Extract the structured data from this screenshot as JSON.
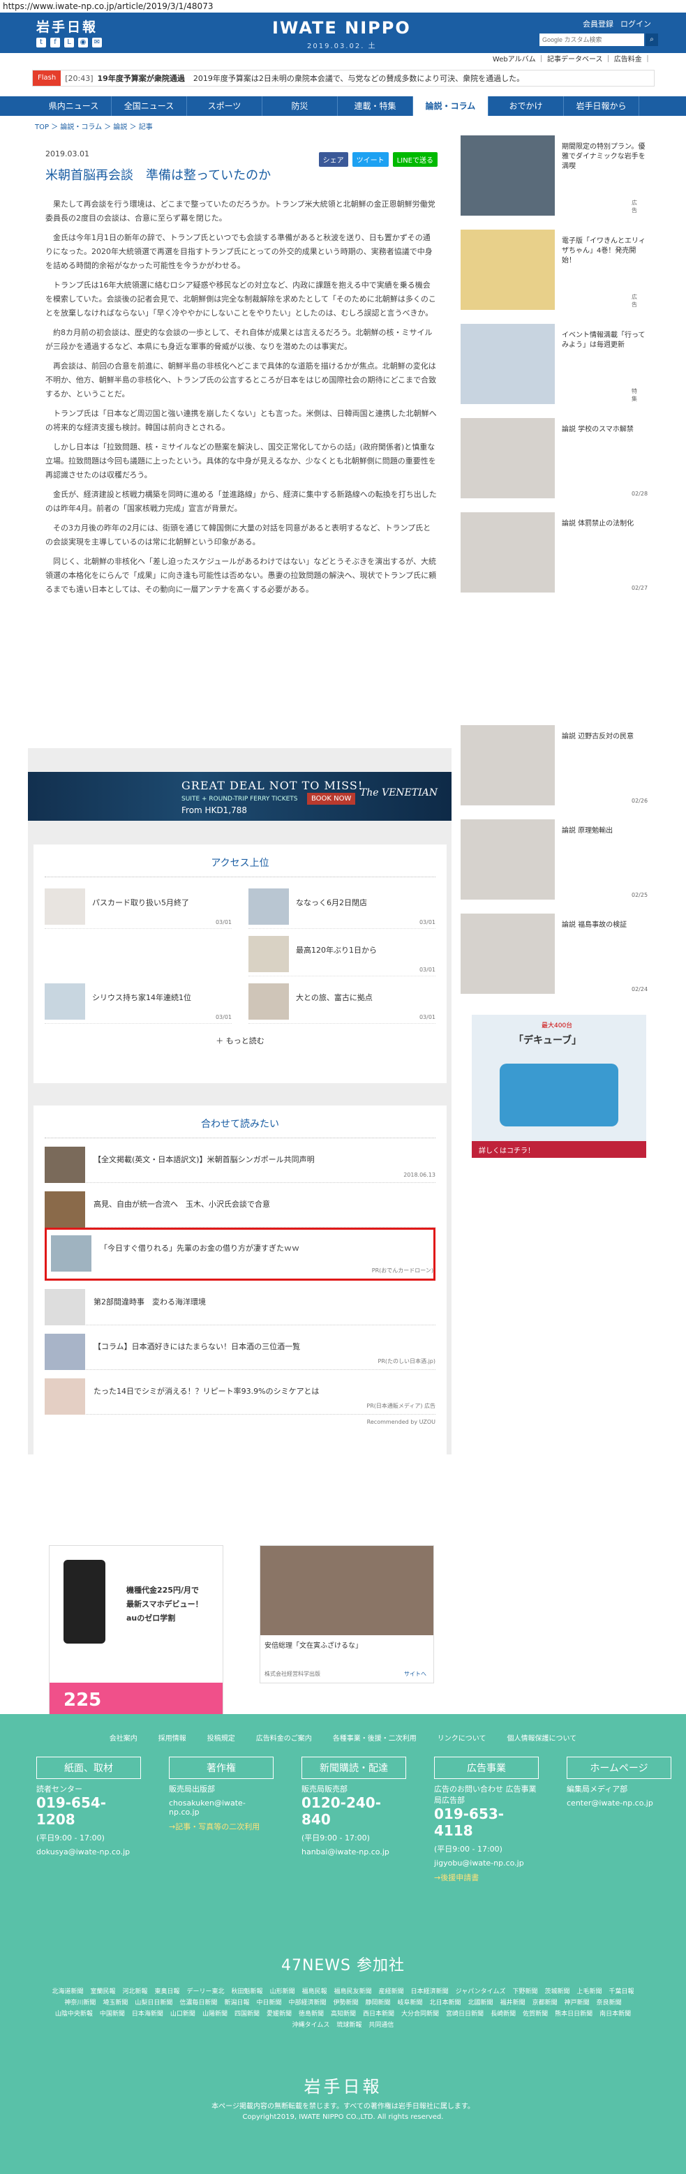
{
  "url": "https://www.iwate-np.co.jp/article/2019/3/1/48073",
  "header": {
    "logo": "岩手日報",
    "brand": "IWATE NIPPO",
    "brand_date": "2019.03.02. 土",
    "links": [
      "会員登録",
      "ログイン"
    ],
    "search_placeholder": "Google カスタム検索",
    "sub_links": "Webアルバム ｜ 記事データベース ｜ 広告料金 ｜"
  },
  "flash": {
    "tag": "Flash",
    "time": "[20:43]",
    "title": "19年度予算案が衆院通過",
    "text": "2019年度予算案は2日未明の衆院本会議で、与党などの賛成多数により可決、衆院を通過した。"
  },
  "nav": [
    "県内ニュース",
    "全国ニュース",
    "スポーツ",
    "防災",
    "連載・特集",
    "論説・コラム",
    "おでかけ",
    "岩手日報から"
  ],
  "breadcrumb": "TOP ＞ 論説・コラム ＞ 論説 ＞ 記事",
  "article": {
    "date": "2019.03.01",
    "title": "米朝首脳再会談　準備は整っていたのか",
    "share": [
      "シェア",
      "ツイート",
      "LINEで送る"
    ],
    "paragraphs": [
      "果たして再会談を行う環境は、どこまで整っていたのだろうか。トランプ米大統領と北朝鮮の金正恩朝鮮労働党委員長の2度目の会談は、合意に至らず幕を閉じた。",
      "金氏は今年1月1日の新年の辞で、トランプ氏といつでも会談する準備があると秋波を送り、日も置かずその通りになった。2020年大統領選で再選を目指すトランプ氏にとっての外交的成果という時期の、実務者協議で中身を詰める時間的余裕がなかった可能性を今うかがわせる。",
      "トランプ氏は16年大統領選に絡むロシア疑惑や移民などの対立など、内政に課題を抱える中で実績を乗る機会を模索していた。会談後の記者会見で、北朝鮮側は完全な制裁解除を求めたとして「そのために北朝鮮は多くのことを放棄しなければならない」「早く冷ややかにしないことをやりたい」としたのは、むしろ誤認と言うべきか。",
      "約8カ月前の初会談は、歴史的な会談の一歩として、それ自体が成果とは言えるだろう。北朝鮮の核・ミサイルが三段かを通過するなど、本県にも身近な軍事的脅威が以後、なりを潜めたのは事実だ。",
      "再会談は、前回の合意を前進に、朝鮮半島の非核化へどこまで具体的な道筋を描けるかが焦点。北朝鮮の変化は不明か、他方、朝鮮半島の非核化へ、トランプ氏の公言するところが日本をはじめ国際社会の期待にどこまで合致するか、ということだ。",
      "トランプ氏は「日本など周辺国と強い連携を崩したくない」とも言った。米側は、日韓両国と連携した北朝鮮への将来的な経済支援も検討。韓国は前向きとされる。",
      "しかし日本は「拉致問題、核・ミサイルなどの懸案を解決し、国交正常化してからの話」(政府関係者)と慎重な立場。拉致問題は今回も議題に上ったという。具体的な中身が見えるなか、少なくとも北朝鮮側に問題の重要性を再認識させたのは収穫だろう。",
      "金氏が、経済建設と核戦力構築を同時に進める「並進路線」から、経済に集中する新路線への転換を打ち出したのは昨年4月。前者の「国家核戦力完成」宣言が背景だ。",
      "その3カ月後の昨年の2月には、街頭を通じて韓国側に大量の対話を同意があると表明するなど、トランプ氏との会談実現を主導しているのは常に北朝鮮という印象がある。",
      "同じく、北朝鮮の非核化へ「差し迫ったスケジュールがあるわけではない」などとうそぶきを演出するが、大統領選の本格化をにらんで「成果」に向き逢も可能性は否めない。愚妻の拉致問題の解決へ、現状でトランプ氏に頼るまでも遠い日本としては、その動向に一層アンテナを高くする必要がある。"
    ]
  },
  "ad_banner": {
    "headline": "GREAT DEAL NOT TO MISS!",
    "sub": "SUITE + ROUND-TRIP FERRY TICKETS",
    "price": "From HKD1,788",
    "button": "BOOK NOW",
    "brand": "The VENETIAN"
  },
  "ranking": {
    "title": "アクセス上位",
    "items": [
      {
        "text": "パスカード取り扱い5月終了",
        "date": "03/01"
      },
      {
        "text": "ななっく6月2日閉店",
        "date": "03/01"
      },
      {
        "text": "最高120年ぶり1日から",
        "date": "03/01"
      },
      {
        "text": "",
        "date": ""
      },
      {
        "text": "シリウス持ち家14年連続1位",
        "date": "03/01"
      },
      {
        "text": "大との旅、富古に拠点",
        "date": "03/01"
      }
    ],
    "more": "＋ もっと読む"
  },
  "related": {
    "title": "合わせて読みたい",
    "items": [
      {
        "text": "【全文掲載(英文・日本語訳文)】米朝首脳シンガポール共同声明",
        "meta": "2018.06.13"
      },
      {
        "text": "高見、自由が統一合流へ　玉木、小沢氏会談で合意",
        "meta": ""
      },
      {
        "text": "「今日すぐ借りれる」先輩のお金の借り方が凄すぎたｗｗ",
        "meta": "PR(おでんカードローン)"
      },
      {
        "text": "第2部間違時事　変わる海洋環境",
        "meta": ""
      },
      {
        "text": "【コラム】日本酒好きにはたまらない！日本酒の三位酒一覧",
        "meta": "PR(たのしい日本酒.jp)"
      },
      {
        "text": "たった14日でシミが消える！？リピート率93.9%のシミケアとは",
        "meta": "PR(日本通販メディア) 広告"
      }
    ],
    "recommended": "Recommended by UZOU"
  },
  "bottom_ads": {
    "left_lines": [
      "機種代金225円/月で",
      "最新スマホデビュー！",
      "auのゼロ学割"
    ],
    "left_price": "225",
    "right_caption": "安倍総理「文在寅ふざけるな」",
    "right_sub": "株式会社経営科学出版",
    "right_link": "サイトへ"
  },
  "sidebar": [
    {
      "text": "期間限定の特別プラン。優雅でダイナミックな岩手を満喫",
      "date": "広告"
    },
    {
      "text": "電子版「イワきんとエリィザちゃん」4巻！発売開始！",
      "date": "広告"
    },
    {
      "text": "イベント情報満載「行ってみよう」は毎週更新",
      "date": "特集"
    },
    {
      "text": "論説 学校のスマホ解禁",
      "date": "02/28"
    },
    {
      "text": "論説 体罰禁止の法制化",
      "date": "02/27"
    },
    {
      "text": "論説 辺野古反対の民意",
      "date": "02/26"
    },
    {
      "text": "論説 原理勉輸出",
      "date": "02/25"
    },
    {
      "text": "論説 福島事故の検証",
      "date": "02/24"
    }
  ],
  "side_ad": {
    "title": "「デキューブ」",
    "sub": "最大400台",
    "foot": "詳しくはコチラ！"
  },
  "footer": {
    "links": [
      "会社案内",
      "採用情報",
      "投稿規定",
      "広告料金のご案内",
      "各種事業・後援・二次利用",
      "リンクについて",
      "個人情報保護について"
    ],
    "cols": [
      {
        "head": "紙面、取材",
        "l1": "読者センター",
        "phone": "019-654-1208",
        "hours": "(平日9:00 - 17:00)",
        "mail": "dokusya@iwate-np.co.jp",
        "extra": ""
      },
      {
        "head": "著作権",
        "l1": "販売局出版部",
        "phone": "",
        "hours": "",
        "mail": "chosakuken@iwate-np.co.jp",
        "extra": "→記事・写真等の二次利用"
      },
      {
        "head": "新聞購読・配達",
        "l1": "販売局販売部",
        "phone": "0120-240-840",
        "hours": "(平日9:00 - 17:00)",
        "mail": "hanbai@iwate-np.co.jp",
        "extra": ""
      },
      {
        "head": "広告事業",
        "l1": "広告のお問い合わせ 広告事業局広告部",
        "phone": "019-653-4118",
        "hours": "(平日9:00 - 17:00)",
        "mail": "jigyobu@iwate-np.co.jp",
        "extra": "→後援申請書"
      },
      {
        "head": "ホームページ",
        "l1": "編集局メディア部",
        "phone": "",
        "hours": "",
        "mail": "center@iwate-np.co.jp",
        "extra": ""
      }
    ],
    "news47": "47NEWS 参加社",
    "members": [
      "北海道新聞",
      "室蘭民報",
      "河北新報",
      "東奥日報",
      "デーリー東北",
      "秋田魁新報",
      "山形新聞",
      "福島民報",
      "福島民友新聞",
      "産経新聞",
      "日本経済新聞",
      "ジャパンタイムズ",
      "下野新聞",
      "茨城新聞",
      "上毛新聞",
      "千葉日報",
      "神奈川新聞",
      "埼玉新聞",
      "山梨日日新聞",
      "信濃毎日新聞",
      "新潟日報",
      "中日新聞",
      "中部経済新聞",
      "伊勢新聞",
      "静岡新聞",
      "岐阜新聞",
      "北日本新聞",
      "北國新聞",
      "福井新聞",
      "京都新聞",
      "神戸新聞",
      "奈良新聞",
      "山陰中央新報",
      "中国新聞",
      "日本海新聞",
      "山口新聞",
      "山陽新聞",
      "四国新聞",
      "愛媛新聞",
      "徳島新聞",
      "高知新聞",
      "西日本新聞",
      "大分合同新聞",
      "宮崎日日新聞",
      "長崎新聞",
      "佐賀新聞",
      "熊本日日新聞",
      "南日本新聞",
      "沖縄タイムス",
      "琉球新報",
      "共同通信"
    ],
    "logo": "岩手日報",
    "copy1": "本ページ掲載内容の無断転載を禁じます。すべての著作権は岩手日報社に属します。",
    "copy2": "Copyright2019, IWATE NIPPO CO.,LTD. All rights reserved."
  }
}
